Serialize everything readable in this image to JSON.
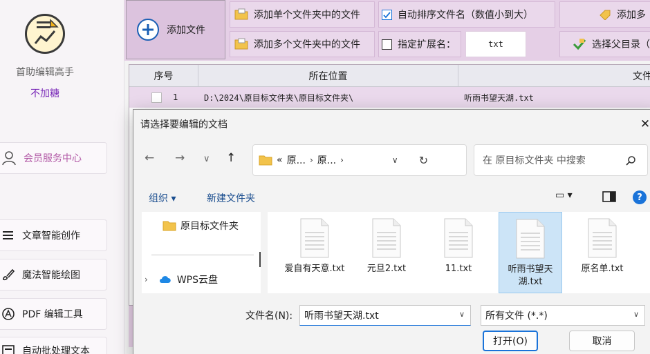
{
  "app": {
    "title": "首助编辑高手",
    "subtitle": "不加糖",
    "sidebar": [
      {
        "label": "会员服务中心",
        "icon": "user-icon"
      },
      {
        "label": "文章智能创作",
        "icon": "menu-lines-icon"
      },
      {
        "label": "魔法智能绘图",
        "icon": "brush-icon"
      },
      {
        "label": "PDF 编辑工具",
        "icon": "pdf-icon"
      },
      {
        "label": "自动批处理文本",
        "icon": "batch-icon"
      }
    ]
  },
  "toolbar": {
    "add_file": "添加文件",
    "add_single": "添加单个文件夹中的文件",
    "add_multi": "添加多个文件夹中的文件",
    "auto_sort": "自动排序文件名（数值小到大）",
    "auto_sort_checked": true,
    "ext_label": "指定扩展名：",
    "ext_checked": false,
    "ext_value": "txt",
    "add_multi2": "添加多",
    "choose_parent": "选择父目录（"
  },
  "table": {
    "columns": [
      "序号",
      "所在位置",
      "文件"
    ],
    "rows": [
      {
        "index": "1",
        "location": "D:\\2024\\原目标文件夹\\原目标文件夹\\",
        "file": "听雨书望天湖.txt"
      }
    ]
  },
  "dialog": {
    "title": "请选择要编辑的文档",
    "close": "✕",
    "breadcrumb": [
      "«",
      "原...",
      "原..."
    ],
    "search_placeholder": "在 原目标文件夹 中搜索",
    "organize": "组织 ▾",
    "new_folder": "新建文件夹",
    "nav_items": [
      {
        "label": "原目标文件夹",
        "icon": "folder-icon"
      },
      {
        "label": "WPS云盘",
        "icon": "cloud-icon"
      }
    ],
    "files": [
      {
        "name": "爱自有天意.txt",
        "selected": false
      },
      {
        "name": "元旦2.txt",
        "selected": false
      },
      {
        "name": "11.txt",
        "selected": false
      },
      {
        "name": "听雨书望天湖.txt",
        "selected": true
      },
      {
        "name": "原名单.txt",
        "selected": false
      }
    ],
    "filename_label": "文件名(N):",
    "filename_value": "听雨书望天湖.txt",
    "filter": "所有文件 (*.*)",
    "open": "打开(O)",
    "cancel": "取消"
  },
  "colors": {
    "accent": "#1a73d9",
    "toolbar_bg": "#e5cfe6",
    "member_text": "#b259a6",
    "subtitle": "#7a2ab8"
  }
}
